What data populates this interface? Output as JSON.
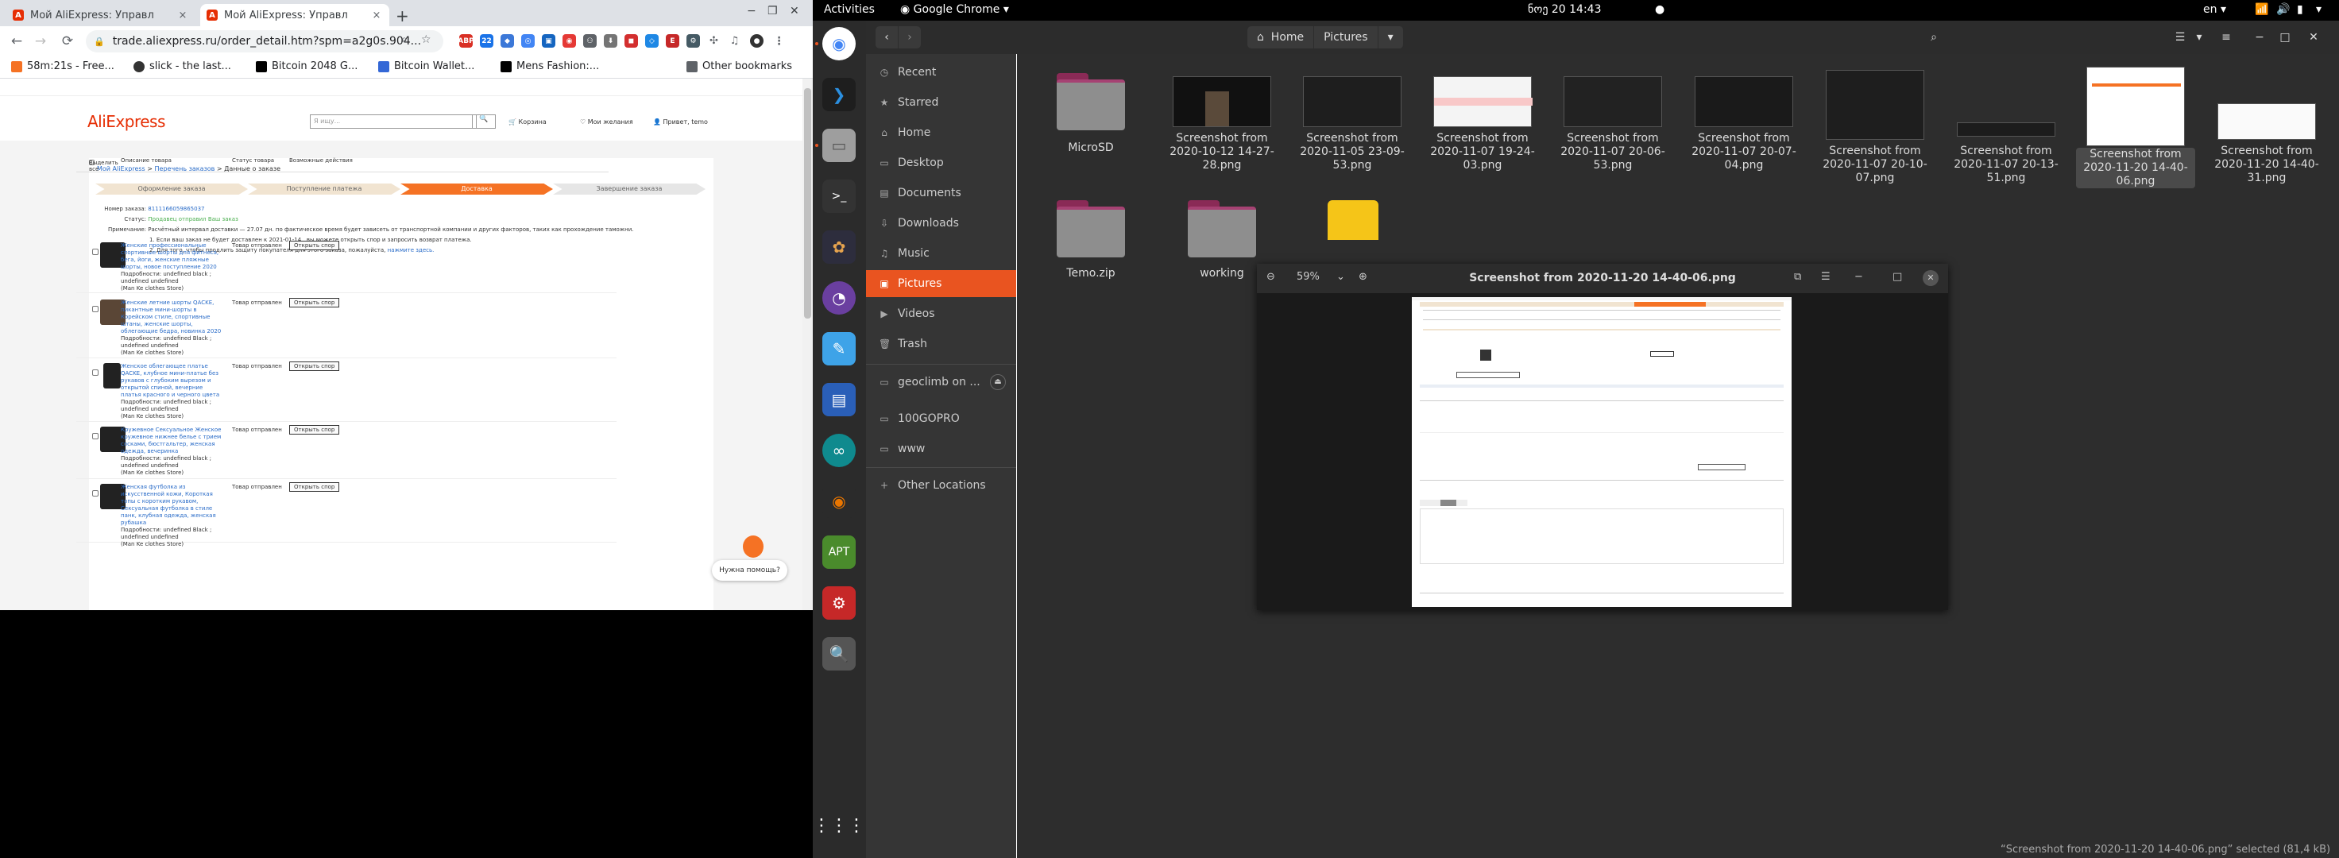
{
  "chrome": {
    "tabs": [
      {
        "title": "Мой AliExpress: Управл",
        "close": "×"
      },
      {
        "title": "Мой AliExpress: Управл",
        "close": "×"
      }
    ],
    "new_tab": "+",
    "win_min": "−",
    "win_max": "❐",
    "win_close": "✕",
    "back": "←",
    "forward": "→",
    "reload": "⟳",
    "url": "trade.aliexpress.ru/order_detail.htm?spm=a2g0s.904...",
    "bookmarks": [
      {
        "label": "58m:21s - Free...",
        "color": "#f57224"
      },
      {
        "label": "slick - the last...",
        "color": "#333333"
      },
      {
        "label": "Bitcoin 2048 G...",
        "color": "#000000"
      },
      {
        "label": "Bitcoin Wallet...",
        "color": "#3367d6"
      },
      {
        "label": "Mens Fashion:...",
        "color": "#000000"
      }
    ],
    "other_bookmarks": "Other bookmarks"
  },
  "aliexpress": {
    "logo": "AliExpress",
    "search_placeholder": "Я ищу...",
    "search_btn": "🔍",
    "cart": "Корзина",
    "wishlist": "Мои желания",
    "greeting": "Привет, temo",
    "crumb_home": "Мой AliExpress",
    "crumb_orders": "Перечень заказов",
    "crumb_current": "Данные о заказе",
    "steps": [
      "Оформление заказа",
      "Поступление платежа",
      "Доставка",
      "Завершение заказа"
    ],
    "order_no_label": "Номер заказа:",
    "order_no": "8111166059865037",
    "status_label": "Статус:",
    "status": "Продавец отправил Ваш заказ",
    "note_label": "Примечание:",
    "note": "Расчётный интервал доставки — 27.07 дн. по фактическое время будет зависеть от транспортной компании и других факторов, таких как прохождение таможни.",
    "note1": "1. Если ваш заказ не будет доставлен к 2021-01-14 , вы можете открыть спор и запросить возврат платежа.",
    "note2": "2. Для того, чтобы продлить защиту покупателя для этого заказа, пожалуйста,",
    "note2_link": "нажмите здесь.",
    "col_select": "Выделить все",
    "col_desc": "Описание товара",
    "col_status": "Статус товара",
    "col_actions": "Возможные действия",
    "rows": [
      {
        "desc": "Женские профессиональные спортивные шорты для фитнеса, бега, йоги, женские пляжные шорты, новое поступление 2020",
        "detail": "Подробности: undefined black ; undefined undefined",
        "store": "(Man Ke clothes Store)",
        "status": "Товар отправлен",
        "btn": "Открыть спор"
      },
      {
        "desc": "Женские летние шорты QACKE, пикантные мини-шорты в Корейском стиле, спортивные штаны, женские шорты, облегающие бедра, новинка 2020",
        "detail": "Подробности: undefined Black ; undefined undefined",
        "store": "(Man Ke clothes Store)",
        "status": "Товар отправлен",
        "btn": "Открыть спор"
      },
      {
        "desc": "Женское облегающее платье QACKE, клубное мини-платье без рукавов с глубоким вырезом и открытой спиной, вечерние платья красного и черного цвета",
        "detail": "Подробности: undefined black ; undefined undefined",
        "store": "(Man Ke clothes Store)",
        "status": "Товар отправлен",
        "btn": "Открыть спор"
      },
      {
        "desc": "Кружевное Сексуальное Женское кружевное нижнее белье с трием сосками, бюстгальтер, женская одежда, вечеринка",
        "detail": "Подробности: undefined black ; undefined undefined",
        "store": "(Man Ke clothes Store)",
        "status": "Товар отправлен",
        "btn": "Открыть спор"
      },
      {
        "desc": "Женская футболка из искусственной кожи, Короткая топы с коротким рукавом, Сексуальная футболка в стиле панк, клубная одежда, женская рубашка",
        "detail": "Подробности: undefined Black ; undefined undefined",
        "store": "(Man Ke clothes Store)",
        "status": "Товар отправлен",
        "btn": "Открыть спор"
      }
    ],
    "help": "Нужна помощь?"
  },
  "topbar": {
    "activities": "Activities",
    "app": "Google Chrome",
    "clock": "ნოე 20  14:43",
    "lang": "en"
  },
  "nautilus": {
    "path_home": "Home",
    "path_current": "Pictures",
    "sidebar": [
      {
        "label": "Recent",
        "icon": "◷"
      },
      {
        "label": "Starred",
        "icon": "★"
      },
      {
        "label": "Home",
        "icon": "⌂"
      },
      {
        "label": "Desktop",
        "icon": "▭"
      },
      {
        "label": "Documents",
        "icon": "▤"
      },
      {
        "label": "Downloads",
        "icon": "⇩"
      },
      {
        "label": "Music",
        "icon": "♫"
      },
      {
        "label": "Pictures",
        "icon": "▣"
      },
      {
        "label": "Videos",
        "icon": "▶"
      },
      {
        "label": "Trash",
        "icon": "🗑"
      },
      {
        "label": "geoclimb on ...",
        "icon": "▭"
      },
      {
        "label": "100GOPRO",
        "icon": "▭"
      },
      {
        "label": "www",
        "icon": "▭"
      },
      {
        "label": "Other Locations",
        "icon": "+"
      }
    ],
    "files": [
      {
        "name": "MicroSD"
      },
      {
        "name": "Screenshot from 2020-10-12 14-27-28.png"
      },
      {
        "name": "Screenshot from 2020-11-05 23-09-53.png"
      },
      {
        "name": "Screenshot from 2020-11-07 19-24-03.png"
      },
      {
        "name": "Screenshot from 2020-11-07 20-06-53.png"
      },
      {
        "name": "Screenshot from 2020-11-07 20-07-04.png"
      },
      {
        "name": "Screenshot from 2020-11-07 20-10-07.png"
      },
      {
        "name": "Screenshot from 2020-11-07 20-13-51.png"
      },
      {
        "name": "Screenshot from 2020-11-20 14-40-06.png"
      },
      {
        "name": "Screenshot from 2020-11-20 14-40-31.png"
      },
      {
        "name": "Temo.zip"
      },
      {
        "name": "working"
      }
    ],
    "status": "“Screenshot from 2020-11-20 14-40-06.png” selected  (81,4 kB)"
  },
  "viewer": {
    "title": "Screenshot from 2020-11-20 14-40-06.png",
    "zoom": "59%"
  }
}
